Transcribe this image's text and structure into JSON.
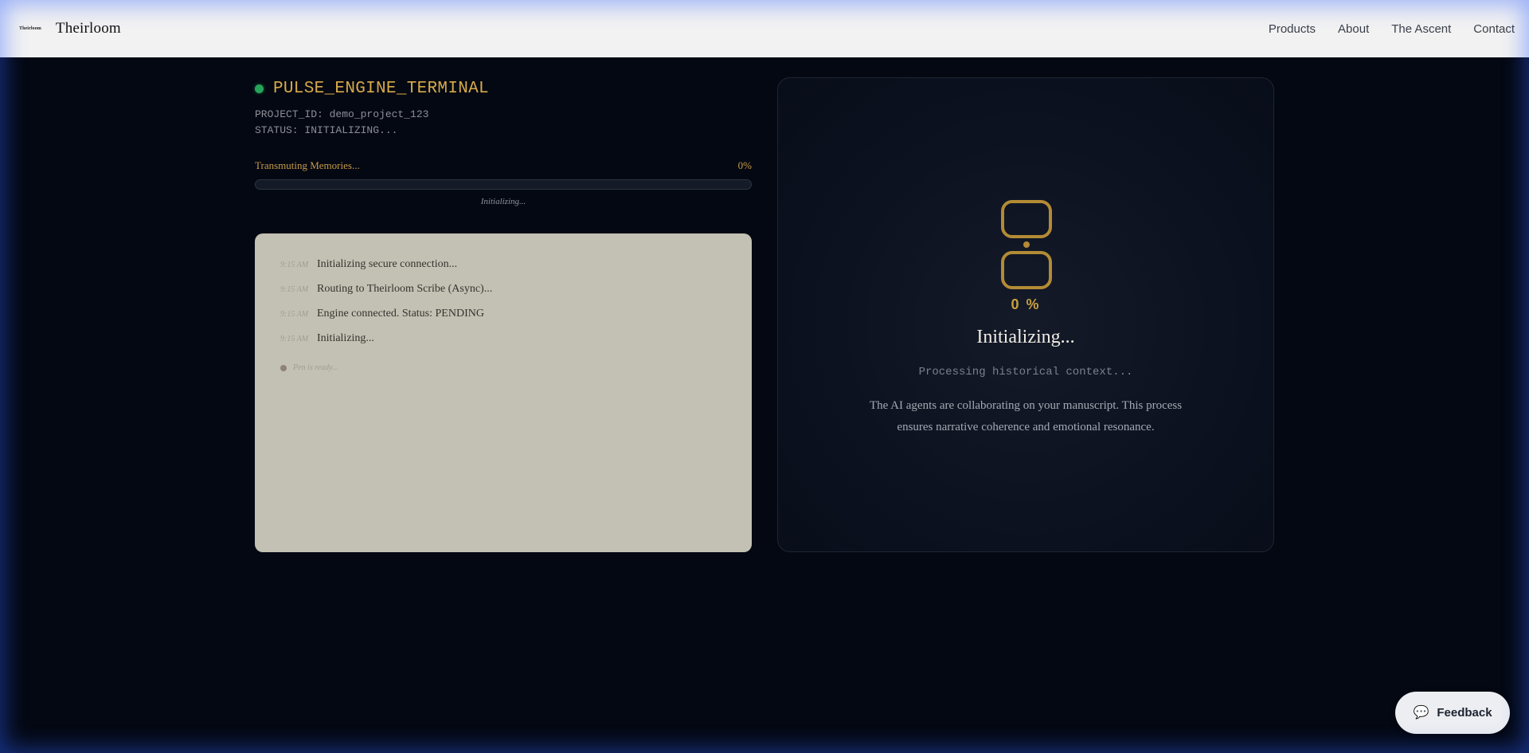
{
  "header": {
    "logo_mark": "Theirloom",
    "brand_name": "Theirloom",
    "nav": [
      "Products",
      "About",
      "The Ascent",
      "Contact"
    ]
  },
  "terminal": {
    "title": "PULSE_ENGINE_TERMINAL",
    "project_line": "PROJECT_ID: demo_project_123",
    "status_line": "STATUS: INITIALIZING...",
    "progress_label": "Transmuting Memories...",
    "progress_percent_text": "0%",
    "progress_fraction": 0,
    "progress_sub": "Initializing...",
    "log": [
      {
        "time": "9:15 AM",
        "message": "Initializing secure connection..."
      },
      {
        "time": "9:15 AM",
        "message": "Routing to Theirloom Scribe (Async)..."
      },
      {
        "time": "9:15 AM",
        "message": "Engine connected. Status: PENDING"
      },
      {
        "time": "9:15 AM",
        "message": "Initializing..."
      }
    ],
    "waiting_text": "Pen is ready..."
  },
  "status_card": {
    "icon": "hourglass-icon",
    "percent": "0 %",
    "title": "Initializing...",
    "subtitle": "Processing historical context...",
    "description": "The AI agents are collaborating on your manuscript. This process ensures narrative coherence and emotional resonance."
  },
  "feedback": {
    "icon": "speech-bubble-icon",
    "label": "Feedback"
  },
  "colors": {
    "background": "#040812",
    "accent_gold": "#d7aa4a",
    "status_green": "#25a55a",
    "log_panel": "#c3c1b3"
  }
}
